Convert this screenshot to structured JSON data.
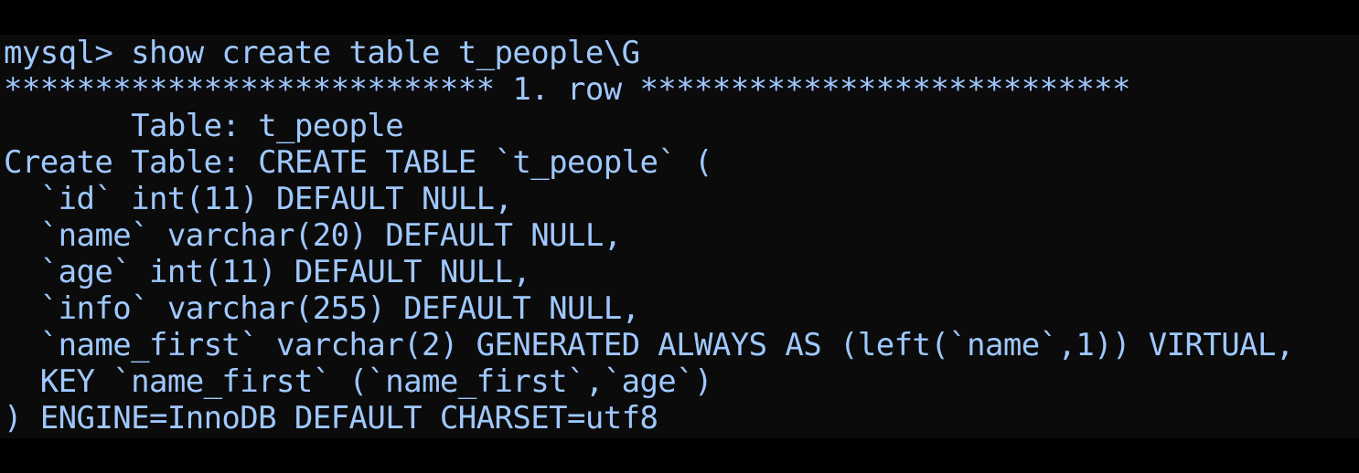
{
  "terminal": {
    "lines": [
      "mysql> show create table t_people\\G",
      "*************************** 1. row ***************************",
      "       Table: t_people",
      "Create Table: CREATE TABLE `t_people` (",
      "  `id` int(11) DEFAULT NULL,",
      "  `name` varchar(20) DEFAULT NULL,",
      "  `age` int(11) DEFAULT NULL,",
      "  `info` varchar(255) DEFAULT NULL,",
      "  `name_first` varchar(2) GENERATED ALWAYS AS (left(`name`,1)) VIRTUAL,",
      "  KEY `name_first` (`name_first`,`age`)",
      ") ENGINE=InnoDB DEFAULT CHARSET=utf8"
    ]
  },
  "colors": {
    "background": "#0b0b0b",
    "text": "#9fc8ff"
  }
}
